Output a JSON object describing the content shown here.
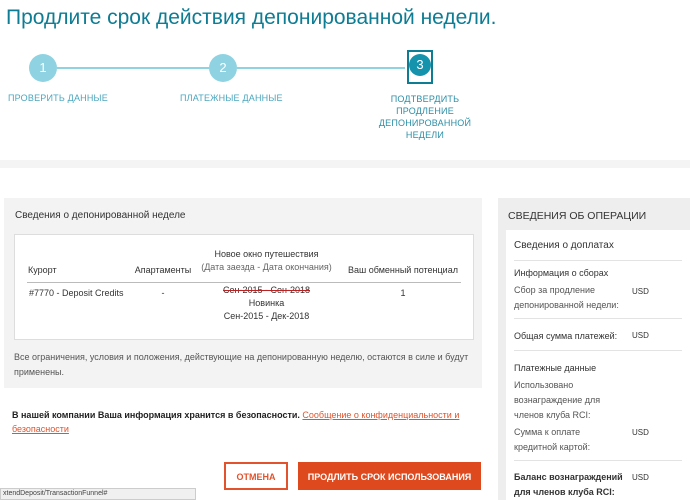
{
  "page": {
    "title": "Продлите срок действия депонированной недели."
  },
  "stepper": {
    "steps": [
      {
        "number": "1",
        "label": "ПРОВЕРИТЬ ДАННЫЕ"
      },
      {
        "number": "2",
        "label": "ПЛАТЕЖНЫЕ ДАННЫЕ"
      },
      {
        "number": "3",
        "label_lines": [
          "ПОДТВЕРДИТЬ",
          "ПРОДЛЕНИЕ",
          "ДЕПОНИРОВАННОЙ",
          "НЕДЕЛИ"
        ]
      }
    ]
  },
  "deposit_panel": {
    "title": "Сведения о депонированной неделе",
    "columns": {
      "resort": "Курорт",
      "apartments": "Апартаменты",
      "new_window": "Новое окно путешествия",
      "new_window_sub": "(Дата заезда - Дата окончания)",
      "exchange_potential": "Ваш обменный потенциал"
    },
    "row": {
      "resort": "#7770 - Deposit Credits",
      "apartments": "-",
      "old_window": "Сен-2015 - Сен-2018",
      "new_label": "Новинка",
      "new_window": "Сен-2015 - Дек-2018",
      "exchange_potential": "1"
    },
    "note": "Все ограничения, условия и положения, действующие на депонированную неделю, остаются в силе и будут применены."
  },
  "security": {
    "text": "В нашей компании Ваша информация хранится в безопасности.",
    "link": "Сообщение о конфиденциальности и безопасности"
  },
  "actions": {
    "cancel": "ОТМЕНА",
    "extend": "ПРОДЛИТЬ СРОК ИСПОЛЬЗОВАНИЯ"
  },
  "statusbar": {
    "url": "xtendDeposit/TransactionFunnel#"
  },
  "sidebar": {
    "title": "СВЕДЕНИЯ ОБ ОПЕРАЦИИ",
    "card_title": "Сведения о доплатах",
    "fees_heading": "Информация о сборах",
    "fee_label": "Сбор за продление депонированной недели:",
    "fee_currency": "USD",
    "total_label": "Общая сумма платежей:",
    "total_currency": "USD",
    "payment_heading": "Платежные данные",
    "rewards_used_label": "Использовано вознаграждение для членов клуба RCI:",
    "card_payment_label": "Сумма к оплате кредитной картой:",
    "card_payment_currency": "USD",
    "balance_label": "Баланс вознаграждений для членов клуба RCI:",
    "balance_currency": "USD"
  },
  "colors": {
    "accent_teal": "#0e7c93",
    "step_inactive": "#8fd3e2",
    "cta_orange": "#de4a1e"
  }
}
